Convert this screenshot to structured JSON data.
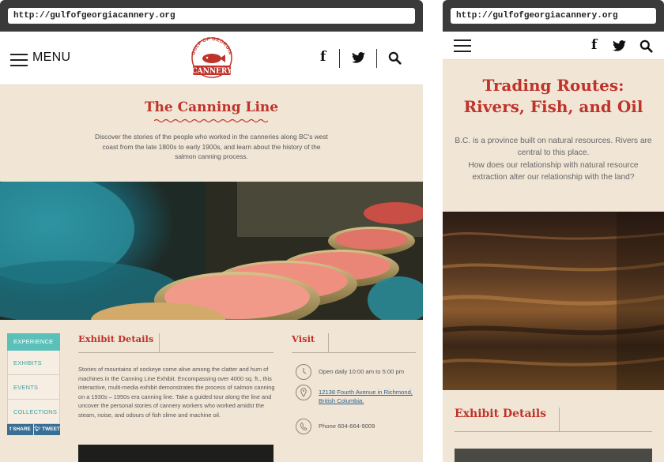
{
  "left": {
    "url": "http://gulfofgeorgiacannery.org",
    "menu_label": "MENU",
    "logo": {
      "top_text": "GULF OF GEORGIA",
      "bottom_text": "CANNERY"
    },
    "social": {
      "facebook": "f",
      "search_icon": "search-icon",
      "twitter_icon": "twitter-icon"
    },
    "intro": {
      "title": "The Canning Line",
      "text": "Discover the stories of the people who worked in the canneries along BC's west coast from the late 1800s to early 1900s, and learn about the history of the salmon canning process."
    },
    "sidenav": {
      "items": [
        "EXPERIENCE",
        "EXHIBITS",
        "EVENTS",
        "COLLECTIONS"
      ],
      "share": "SHARE",
      "tweet": "TWEET"
    },
    "exhibit": {
      "title": "Exhibit Details",
      "text": "Stories of mountains of sockeye come alive among the clatter and hum of machines in the Canning Line Exhibit. Encompassing over 4000 sq. ft., this interactive, multi-media exhibit demonstrates the process of salmon canning on a 1930s – 1950s era canning line. Take a guided tour along the line and uncover the personal stories of cannery workers who worked amidst the steam, noise, and odours of fish slime and machine oil."
    },
    "visit": {
      "title": "Visit",
      "hours": "Open daily 10:00 am to 5:00 pm",
      "address": "12138 Fourth Avenue in Richmond, British Columbia.",
      "phone": "Phone 604-664-9009"
    }
  },
  "right": {
    "url": "http://gulfofgeorgiacannery.org",
    "title": "Trading Routes: Rivers, Fish, and Oil",
    "text_line1": "B.C. is a province built on natural resources. Rivers are central to this place.",
    "text_line2": "How does our relationship with natural resource extraction alter our relationship with the land?",
    "section_title": "Exhibit Details"
  },
  "colors": {
    "accent_red": "#c0332a",
    "teal": "#5bbfba",
    "paper": "#f1e6d6",
    "share_blue": "#3a6e95"
  }
}
